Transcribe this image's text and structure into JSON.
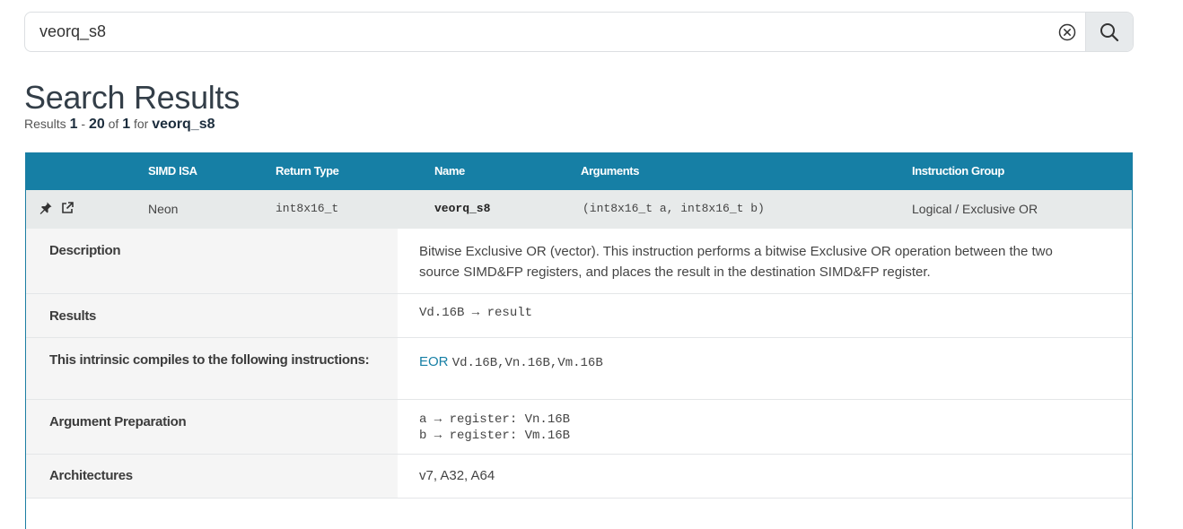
{
  "search": {
    "value": "veorq_s8",
    "clear_icon": "circle-x-icon",
    "search_icon": "magnifier-icon"
  },
  "page": {
    "title": "Search Results",
    "summary": {
      "prefix": "Results",
      "start": "1",
      "sep": "-",
      "end": "20",
      "of_word": "of",
      "total": "1",
      "for_word": "for",
      "query": "veorq_s8"
    }
  },
  "table": {
    "headers": {
      "isa": "SIMD ISA",
      "return_type": "Return Type",
      "name": "Name",
      "arguments": "Arguments",
      "group": "Instruction Group"
    },
    "row": {
      "isa": "Neon",
      "return_type": "int8x16_t",
      "name": "veorq_s8",
      "arguments": "(int8x16_t a, int8x16_t b)",
      "group": "Logical / Exclusive OR"
    },
    "details": {
      "description_label": "Description",
      "description_value": "Bitwise Exclusive OR (vector). This instruction performs a bitwise Exclusive OR operation between the two source SIMD&FP registers, and places the result in the destination SIMD&FP register.",
      "results_label": "Results",
      "results_value": "Vd.16B → result",
      "compiles_label": "This intrinsic compiles to the following instructions:",
      "compiles_mnemonic": "EOR",
      "compiles_operands": "Vd.16B,Vn.16B,Vm.16B",
      "argprep_label": "Argument Preparation",
      "argprep_line1": "a → register: Vn.16B",
      "argprep_line2": "b → register: Vm.16B",
      "arch_label": "Architectures",
      "arch_value": "v7, A32, A64"
    }
  },
  "colors": {
    "header_bg": "#167fa5",
    "row_bg": "#e7eaea",
    "link": "#167fa5"
  }
}
